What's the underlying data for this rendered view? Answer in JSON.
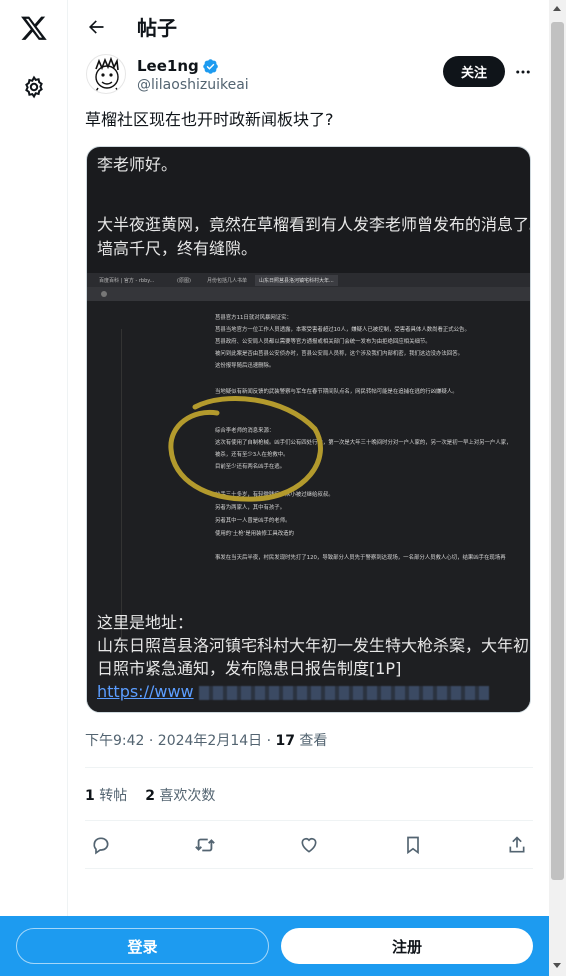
{
  "header": {
    "title": "帖子"
  },
  "author": {
    "name": "Lee1ng",
    "handle": "@lilaoshizuikeai",
    "follow_label": "关注"
  },
  "tweet": {
    "text": "草榴社区现在也开时政新闻板块了?"
  },
  "media": {
    "line1": "李老师好。",
    "line2": "大半夜逛黄网，竟然在草榴看到有人发李老师曾发布的消息了。",
    "line3": "墙高千尺，终有缝隙。",
    "inner_lines": [
      "莒县官方11日就对风暴网证实：",
      "莒县当地官方一位工作人员透露，本案受害者超过10人，嫌疑人已被控制，受害者具体人数尚看正式公告。",
      "莒县政府、公安局人员都以需要等官方通报或相关部门会统一发布为由拒绝回应相关细节。",
      "被问到此案是否由莒县公安侦办时，莒县公安局人员称，这个涉及我们内部机密，我们这边没办法回答。",
      "这份报导随后迅速删除。",
      "当地疑似有新闻反馈的武装警察与军车在春节期间队点名，网民转帖可能是在追捕在逃的行凶嫌疑人。",
      "综合李老师的消息来源：",
      "这次有使用了自制枪械。凶手们公有四处行凶，第一次是大年三十晚间时分对一户人家的，另一次是初一早上对另一户人家，",
      "被杀，还有至少3人在抢救中。",
      "目前至少还有两名凶手在逃。",
      "凶手三十多岁，有轻微残疾，从小被过继给叔叔。",
      "另者为两家人，其中有孩子。",
      "另者其中一人曾是凶手的老师。",
      "使用的‘土枪’是用装修工具改造的",
      "事发在当天后半夜，村民发现时先打了120，导致部分人员先于警察到达现场，一名部分人员救人心切，结果凶手在现场再"
    ],
    "inner_tabs": [
      "百度百科 | 官方 - rbby...",
      "(原图)",
      "月份包括几人书单",
      "山东日照莒县洛河镇宅科村大年..."
    ],
    "address_label": "这里是地址：",
    "address_line": "山东日照莒县洛河镇宅科村大年初一发生特大枪杀案，大年初1",
    "address_line2": "日照市紧急通知，发布隐患日报告制度[1P]",
    "link_prefix": "https://www"
  },
  "meta": {
    "time": "下午9:42 · 2024年2月14日 · ",
    "views_count": "17",
    "views_label": " 查看"
  },
  "stats": {
    "reposts_count": "1",
    "reposts_label": "转帖",
    "likes_count": "2",
    "likes_label": "喜欢次数"
  },
  "bottom_bar": {
    "login_label": "登录",
    "signup_label": "注册"
  },
  "colors": {
    "accent": "#1d9bf0",
    "verified": "#1d9bf0",
    "text": "#0f1419",
    "muted": "#536471",
    "highlight_circle": "#b39a2d"
  },
  "icons": [
    "x-logo-icon",
    "gear-icon",
    "back-arrow-icon",
    "verified-badge-icon",
    "more-icon",
    "reply-icon",
    "repost-icon",
    "like-icon",
    "bookmark-icon",
    "share-icon"
  ]
}
